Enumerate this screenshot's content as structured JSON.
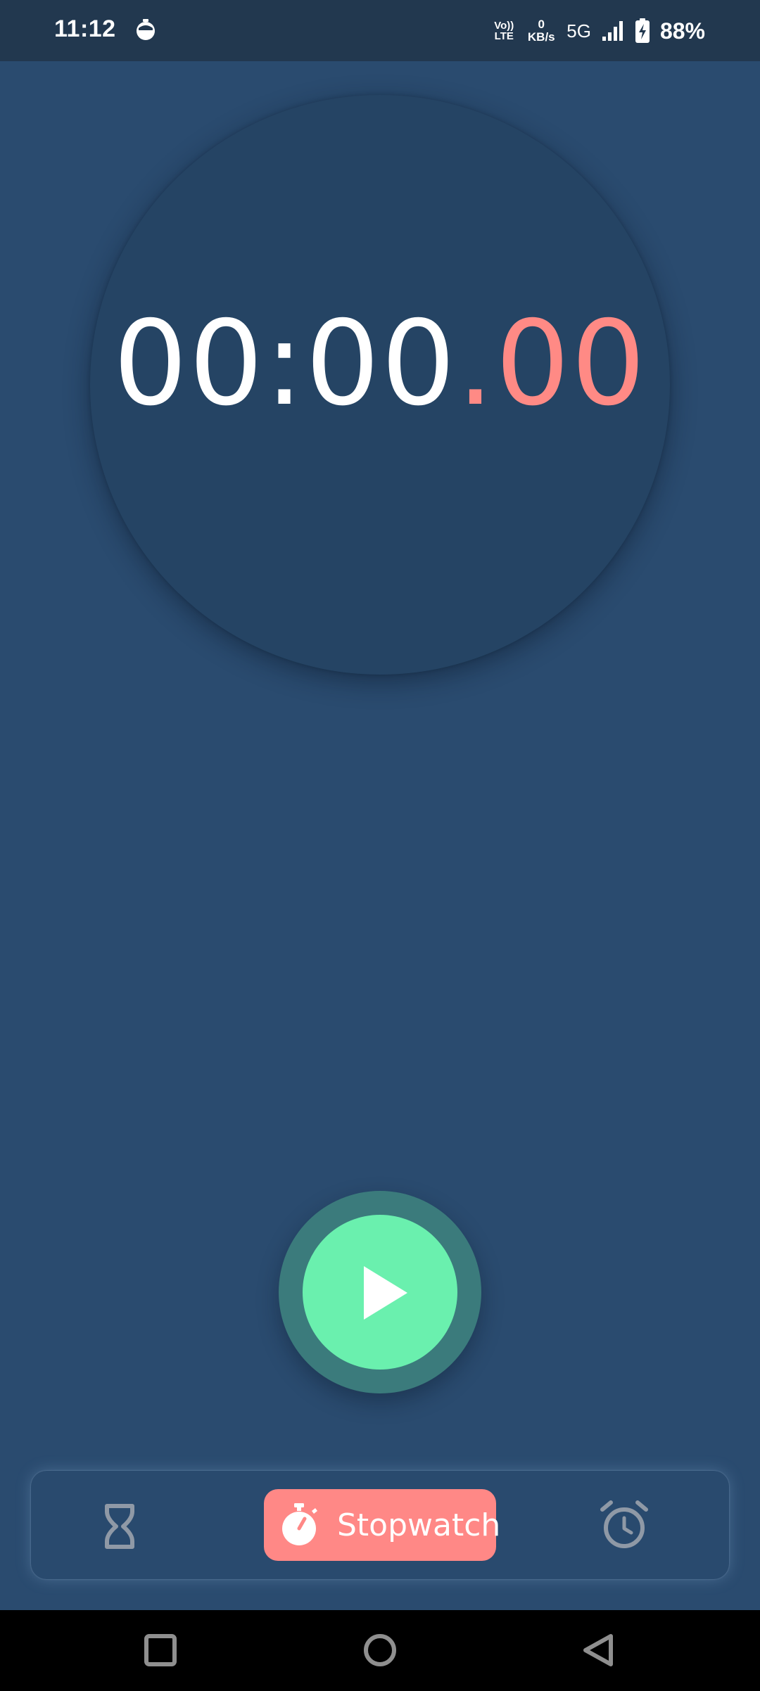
{
  "status_bar": {
    "time": "11:12",
    "app_icon": "stopwatch-app-icon",
    "volte_line1": "Vo))",
    "volte_line2": "LTE",
    "speed_value": "0",
    "speed_unit": "KB/s",
    "network_type": "5G",
    "battery_percent": "88%"
  },
  "stopwatch": {
    "time_main": "00:00",
    "time_dot": ".",
    "time_centiseconds": "00",
    "play_icon": "play-icon"
  },
  "bottom_nav": {
    "items": [
      {
        "id": "timer",
        "icon": "hourglass-icon"
      },
      {
        "id": "stopwatch",
        "icon": "stopwatch-icon",
        "label": "Stopwatch",
        "active": true
      },
      {
        "id": "alarm",
        "icon": "alarm-clock-icon"
      }
    ]
  },
  "system_nav": {
    "items": [
      "recents-icon",
      "home-icon",
      "back-icon"
    ]
  },
  "colors": {
    "background": "#2a4b6f",
    "status_bar": "#22384f",
    "dial": "#254464",
    "accent_red": "#ff8886",
    "play_green": "#6af0ae",
    "play_ring": "#3b7b7c",
    "inactive_icon": "#8f99a6"
  }
}
